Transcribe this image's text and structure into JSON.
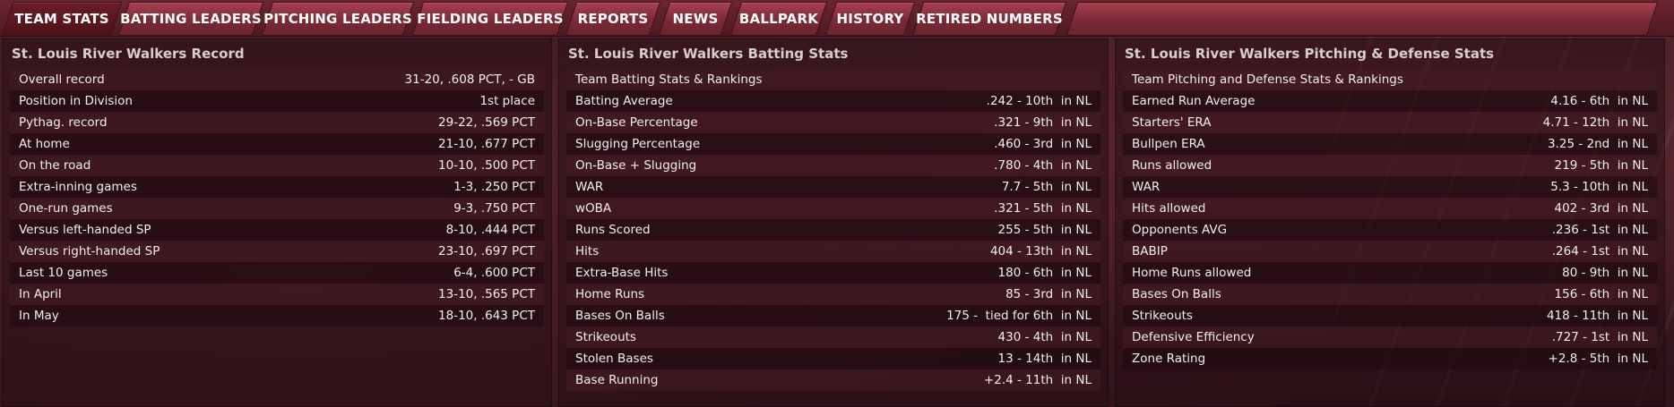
{
  "tabs": [
    {
      "label": "TEAM STATS",
      "active": true
    },
    {
      "label": "BATTING LEADERS",
      "active": false
    },
    {
      "label": "PITCHING LEADERS",
      "active": false
    },
    {
      "label": "FIELDING LEADERS",
      "active": false
    },
    {
      "label": "REPORTS",
      "active": false
    },
    {
      "label": "NEWS",
      "active": false
    },
    {
      "label": "BALLPARK",
      "active": false
    },
    {
      "label": "HISTORY",
      "active": false
    },
    {
      "label": "RETIRED NUMBERS",
      "active": false
    }
  ],
  "record": {
    "title": "St. Louis River Walkers Record",
    "rows": [
      {
        "label": "Overall record",
        "value": "31-20, .608 PCT, - GB"
      },
      {
        "label": "Position in Division",
        "value": "1st place"
      },
      {
        "label": "Pythag. record",
        "value": "29-22, .569 PCT"
      },
      {
        "label": "At home",
        "value": "21-10, .677 PCT"
      },
      {
        "label": "On the road",
        "value": "10-10, .500 PCT"
      },
      {
        "label": "Extra-inning games",
        "value": "1-3, .250 PCT"
      },
      {
        "label": "One-run games",
        "value": "9-3, .750 PCT"
      },
      {
        "label": "Versus left-handed SP",
        "value": "8-10, .444 PCT"
      },
      {
        "label": "Versus right-handed SP",
        "value": "23-10, .697 PCT"
      },
      {
        "label": "Last 10 games",
        "value": "6-4, .600 PCT"
      },
      {
        "label": "In April",
        "value": "13-10, .565 PCT"
      },
      {
        "label": "In May",
        "value": "18-10, .643 PCT"
      }
    ]
  },
  "batting": {
    "title": "St. Louis River Walkers Batting Stats",
    "subheader": "Team Batting Stats & Rankings",
    "rows": [
      {
        "label": "Batting Average",
        "value": ".242 - 10th  in NL"
      },
      {
        "label": "On-Base Percentage",
        "value": ".321 - 9th  in NL"
      },
      {
        "label": "Slugging Percentage",
        "value": ".460 - 3rd  in NL"
      },
      {
        "label": "On-Base + Slugging",
        "value": ".780 - 4th  in NL"
      },
      {
        "label": "WAR",
        "value": "7.7 - 5th  in NL"
      },
      {
        "label": "wOBA",
        "value": ".321 - 5th  in NL"
      },
      {
        "label": "Runs Scored",
        "value": "255 - 5th  in NL"
      },
      {
        "label": "Hits",
        "value": "404 - 13th  in NL"
      },
      {
        "label": "Extra-Base Hits",
        "value": "180 - 6th  in NL"
      },
      {
        "label": "Home Runs",
        "value": "85 - 3rd  in NL"
      },
      {
        "label": "Bases On Balls",
        "value": "175 -  tied for 6th  in NL"
      },
      {
        "label": "Strikeouts",
        "value": "430 - 4th  in NL"
      },
      {
        "label": "Stolen Bases",
        "value": "13 - 14th  in NL"
      },
      {
        "label": "Base Running",
        "value": "+2.4 - 11th  in NL"
      }
    ]
  },
  "pitching": {
    "title": "St. Louis River Walkers Pitching & Defense Stats",
    "subheader": "Team Pitching and Defense Stats & Rankings",
    "rows": [
      {
        "label": "Earned Run Average",
        "value": "4.16 - 6th  in NL"
      },
      {
        "label": "Starters' ERA",
        "value": "4.71 - 12th  in NL"
      },
      {
        "label": "Bullpen ERA",
        "value": "3.25 - 2nd  in NL"
      },
      {
        "label": "Runs allowed",
        "value": "219 - 5th  in NL"
      },
      {
        "label": "WAR",
        "value": "5.3 - 10th  in NL"
      },
      {
        "label": "Hits allowed",
        "value": "402 - 3rd  in NL"
      },
      {
        "label": "Opponents AVG",
        "value": ".236 - 1st  in NL"
      },
      {
        "label": "BABIP",
        "value": ".264 - 1st  in NL"
      },
      {
        "label": "Home Runs allowed",
        "value": "80 - 9th  in NL"
      },
      {
        "label": "Bases On Balls",
        "value": "156 - 6th  in NL"
      },
      {
        "label": "Strikeouts",
        "value": "418 - 11th  in NL"
      },
      {
        "label": "Defensive Efficiency",
        "value": ".727 - 1st  in NL"
      },
      {
        "label": "Zone Rating",
        "value": "+2.8 - 5th  in NL"
      }
    ]
  }
}
